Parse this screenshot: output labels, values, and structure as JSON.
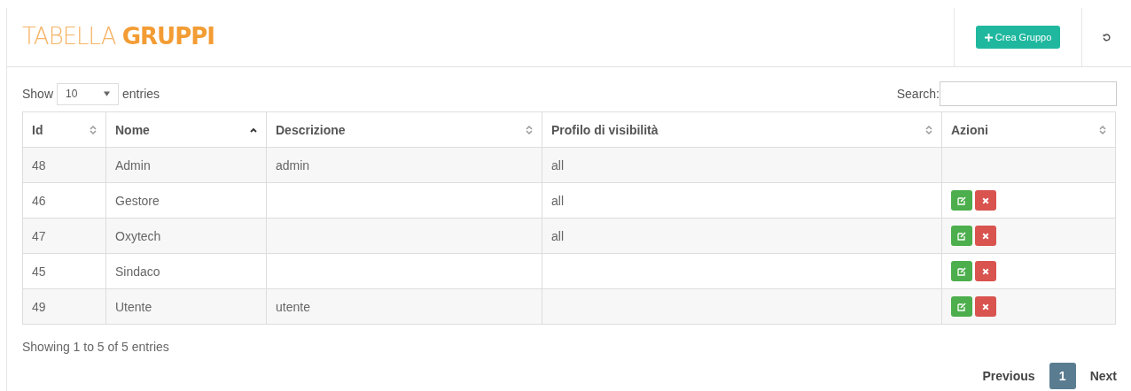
{
  "title": {
    "light": "TABELLA",
    "bold": "GRUPPI"
  },
  "create_button": "Crea Gruppo",
  "length": {
    "label_before": "Show",
    "value": "10",
    "label_after": "entries"
  },
  "search": {
    "label": "Search:"
  },
  "table": {
    "columns": [
      {
        "label": "Id",
        "sorted": false
      },
      {
        "label": "Nome",
        "sorted": true
      },
      {
        "label": "Descrizione",
        "sorted": false
      },
      {
        "label": "Profilo di visibilità",
        "sorted": false
      },
      {
        "label": "Azioni",
        "sorted": false
      }
    ],
    "rows": [
      {
        "cells": [
          "48",
          "Admin",
          "admin",
          "all"
        ],
        "actions": false
      },
      {
        "cells": [
          "46",
          "Gestore",
          "",
          "all"
        ],
        "actions": true
      },
      {
        "cells": [
          "47",
          "Oxytech",
          "",
          "all"
        ],
        "actions": true
      },
      {
        "cells": [
          "45",
          "Sindaco",
          "",
          ""
        ],
        "actions": true
      },
      {
        "cells": [
          "49",
          "Utente",
          "utente",
          ""
        ],
        "actions": true
      }
    ]
  },
  "info": "Showing 1 to 5 of 5 entries",
  "pagination": {
    "previous": "Previous",
    "pages": [
      {
        "label": "1",
        "selected": true
      }
    ],
    "next": "Next"
  }
}
